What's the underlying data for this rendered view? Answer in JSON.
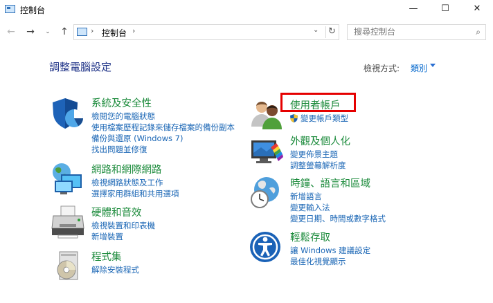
{
  "window": {
    "title": "控制台",
    "minimize_glyph": "—",
    "maximize_glyph": "☐",
    "close_glyph": "✕"
  },
  "nav": {
    "back_glyph": "←",
    "forward_glyph": "→",
    "recent_glyph": "⌄",
    "up_glyph": "↑",
    "breadcrumb_sep": "›",
    "address": "控制台",
    "dropdown_glyph": "⌄",
    "refresh_glyph": "↻",
    "search_placeholder": "搜尋控制台",
    "search_glyph": "⌕"
  },
  "header": {
    "title": "調整電腦設定",
    "view_by_label": "檢視方式:",
    "view_by_value": "類別"
  },
  "categories": [
    {
      "title": "系統及安全性",
      "icon": "shield-pie-icon",
      "links": [
        "檢閱您的電腦狀態",
        "使用檔案歷程記錄來儲存檔案的備份副本",
        "備份與還原 (Windows 7)",
        "找出問題並修復"
      ]
    },
    {
      "title": "網路和網際網路",
      "icon": "network-globe-icon",
      "links": [
        "檢視網路狀態及工作",
        "選擇家用群組和共用選項"
      ]
    },
    {
      "title": "硬體和音效",
      "icon": "printer-icon",
      "links": [
        "檢視裝置和印表機",
        "新增裝置"
      ]
    },
    {
      "title": "程式集",
      "icon": "programs-disc-icon",
      "links": [
        "解除安裝程式"
      ]
    },
    {
      "title": "使用者帳戶",
      "icon": "users-icon",
      "links": [
        "變更帳戶類型"
      ]
    },
    {
      "title": "外觀及個人化",
      "icon": "monitor-palette-icon",
      "links": [
        "變更佈景主題",
        "調整螢幕解析度"
      ]
    },
    {
      "title": "時鐘、語言和區域",
      "icon": "clock-globe-icon",
      "links": [
        "新增語言",
        "變更輸入法",
        "變更日期、時間或數字格式"
      ]
    },
    {
      "title": "輕鬆存取",
      "icon": "accessibility-icon",
      "links": [
        "讓 Windows 建議設定",
        "最佳化視覺顯示"
      ]
    }
  ],
  "colors": {
    "category_title": "#1a8a3a",
    "link": "#1a66b5",
    "highlight_box": "#e50000",
    "page_title": "#1e3287"
  }
}
